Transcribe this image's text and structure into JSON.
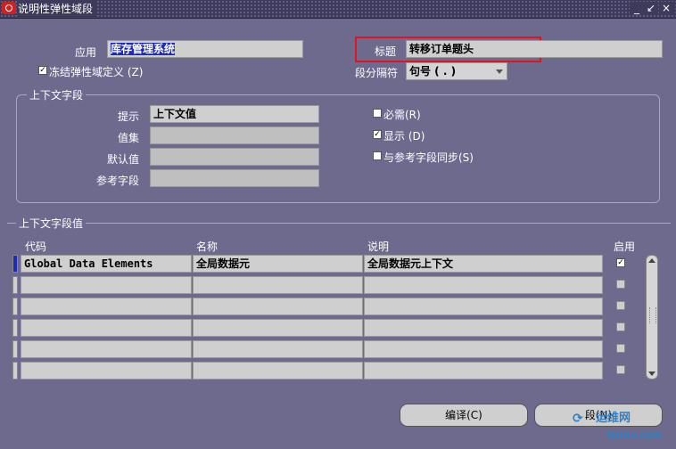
{
  "window": {
    "title": "说明性弹性域段",
    "controls": [
      "_",
      "↙",
      "×"
    ]
  },
  "header": {
    "app_label": "应用",
    "app_value": "库存管理系统",
    "title_label": "标题",
    "title_value": "转移订单题头",
    "freeze_label": "冻结弹性域定义 (Z)",
    "freeze_checked": true,
    "separator_label": "段分隔符",
    "separator_value": "句号 ( . )"
  },
  "context_field": {
    "group_title": "上下文字段",
    "prompt_label": "提示",
    "prompt_value": "上下文值",
    "value_set_label": "值集",
    "value_set_value": "",
    "default_label": "默认值",
    "default_value": "",
    "reference_label": "参考字段",
    "reference_value": "",
    "required_label": "必需(R)",
    "required_checked": false,
    "display_label": "显示 (D)",
    "display_checked": true,
    "sync_label": "与参考字段同步(S)",
    "sync_checked": false
  },
  "context_values": {
    "group_title": "上下文字段值",
    "columns": {
      "code": "代码",
      "name": "名称",
      "description": "说明",
      "enabled": "启用"
    },
    "rows": [
      {
        "code": "Global Data Elements",
        "name": "全局数据元",
        "description": "全局数据元上下文",
        "enabled": true
      },
      {
        "code": "",
        "name": "",
        "description": "",
        "enabled": false
      },
      {
        "code": "",
        "name": "",
        "description": "",
        "enabled": false
      },
      {
        "code": "",
        "name": "",
        "description": "",
        "enabled": false
      },
      {
        "code": "",
        "name": "",
        "description": "",
        "enabled": false
      },
      {
        "code": "",
        "name": "",
        "description": "",
        "enabled": false
      }
    ]
  },
  "buttons": {
    "compile": "编译(C)",
    "segments": "段(N)"
  },
  "watermark": {
    "line1": "运维网",
    "line2": "iyunv.com"
  },
  "colors": {
    "background": "#6e6a8e",
    "selection": "#1e2ab8",
    "highlight_box": "#e0141e"
  }
}
